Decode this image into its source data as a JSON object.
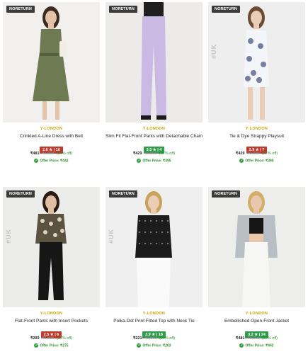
{
  "products": [
    {
      "badge": "NORETURN",
      "watermark": "",
      "brand": "Y-LONDON",
      "title": "Crinkled A-Line Dress with Belt",
      "rating": "2.6 ★ | 10",
      "rating_color": "#c0392b",
      "price": "₹481",
      "mrp": "₹6,899",
      "discount": "(87% off)",
      "offer": "Offer Price: ₹442",
      "image_bg": "#f1f0ee",
      "garment_color": "#6e7b52",
      "skin_color": "#e3c2a7",
      "hair_color": "#3a2a20",
      "look": "dress"
    },
    {
      "badge": "NORETURN",
      "watermark": "",
      "brand": "Y-LONDON",
      "title": "Slim Fit Flat-Front Pants with Detachable Chain",
      "rating": "3.5 ★ | 4",
      "rating_color": "#2e9c4a",
      "price": "₹429",
      "mrp": "₹6,899",
      "discount": "(87% off)",
      "offer": "Offer Price: ₹395",
      "image_bg": "#ecebea",
      "garment_color": "#c9b9e3",
      "skin_color": "#e6c6ae",
      "hair_color": "#2d2d2d",
      "look": "pants"
    },
    {
      "badge": "NORETURN",
      "watermark": "#UK",
      "brand": "Y-LONDON",
      "title": "Tie & Dye Strappy Playsuit",
      "rating": "2.9 ★ | 7",
      "rating_color": "#c0392b",
      "price": "₹429",
      "mrp": "₹5,899",
      "discount": "(87% off)",
      "offer": "Offer Price: ₹395",
      "image_bg": "#eeeeee",
      "garment_color": "#f4f5f8",
      "skin_color": "#eacdb6",
      "hair_color": "#6b4a33",
      "look": "playsuit"
    },
    {
      "badge": "NORETURN",
      "watermark": "#UK",
      "brand": "Y-LONDON",
      "title": "Flat-Front Pants with Insert Pockets",
      "rating": "2.5 ★ | 6",
      "rating_color": "#c0392b",
      "price": "₹299",
      "mrp": "₹6,899",
      "discount": "(87% off)",
      "offer": "Offer Price: ₹275",
      "image_bg": "#ececeb",
      "garment_color": "#161616",
      "skin_color": "#e0bfa5",
      "hair_color": "#2a1c14",
      "look": "blackpants"
    },
    {
      "badge": "NORETURN",
      "watermark": "#UK",
      "brand": "Y-LONDON",
      "title": "Polka-Dot Print Fitted Top with Neck Tie",
      "rating": "3.9 ★ | 18",
      "rating_color": "#2e9c4a",
      "price": "₹221",
      "mrp": "₹6,899",
      "discount": "(87% off)",
      "offer": "Offer Price: ₹203",
      "image_bg": "#efefef",
      "garment_color": "#1c1c1c",
      "skin_color": "#ebcdb5",
      "hair_color": "#c9a35a",
      "look": "top"
    },
    {
      "badge": "NORETURN",
      "watermark": "",
      "brand": "Y-LONDON",
      "title": "Embellished Open-Front Jacket",
      "rating": "3.2 ★ | 24",
      "rating_color": "#2e9c4a",
      "price": "₹481",
      "mrp": "₹6,899",
      "discount": "(87% off)",
      "offer": "Offer Price: ₹442",
      "image_bg": "#ededec",
      "garment_color": "#b9bec4",
      "skin_color": "#e8c7ad",
      "hair_color": "#d2ae67",
      "look": "jacket"
    }
  ]
}
